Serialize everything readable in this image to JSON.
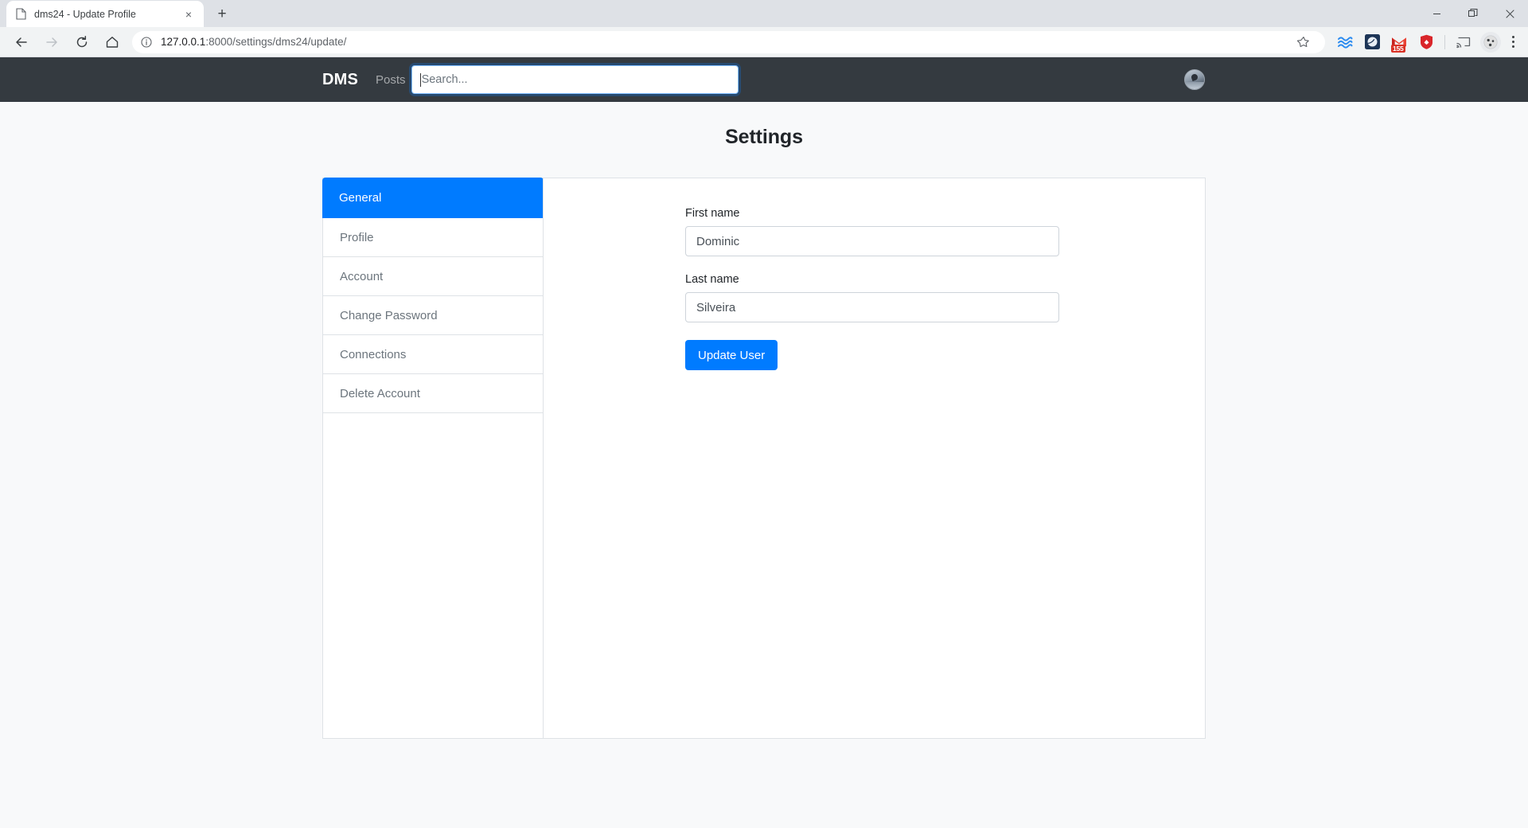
{
  "browser": {
    "tab": {
      "title": "dms24 - Update Profile",
      "favicon": "page-icon",
      "close": "×"
    },
    "new_tab": "+",
    "window_controls": {
      "minimize": "−",
      "maximize": "❐",
      "close": "✕"
    },
    "nav": {
      "back": "←",
      "forward": "→",
      "reload": "⟳",
      "home": "⌂"
    },
    "omnibox": {
      "info_icon": "info-icon",
      "url_host": "127.0.0.1",
      "url_path": ":8000/settings/dms24/update/",
      "bookmark_icon": "☆"
    },
    "extensions": [
      {
        "name": "wave-extension-icon",
        "badge": ""
      },
      {
        "name": "pocket-extension-icon",
        "badge": ""
      },
      {
        "name": "gmail-extension-icon",
        "badge": "155"
      },
      {
        "name": "shield-extension-icon",
        "badge": ""
      },
      {
        "name": "cast-icon",
        "badge": ""
      }
    ],
    "profile_avatar": "profile-avatar",
    "menu": "three-dot-menu"
  },
  "app": {
    "navbar": {
      "brand": "DMS",
      "posts_link": "Posts",
      "search_placeholder": "Search...",
      "avatar": "user-avatar"
    },
    "page_title": "Settings",
    "sidebar": {
      "items": [
        {
          "label": "General",
          "active": true
        },
        {
          "label": "Profile",
          "active": false
        },
        {
          "label": "Account",
          "active": false
        },
        {
          "label": "Change Password",
          "active": false
        },
        {
          "label": "Connections",
          "active": false
        },
        {
          "label": "Delete Account",
          "active": false
        }
      ]
    },
    "form": {
      "first_name_label": "First name",
      "first_name_value": "Dominic",
      "last_name_label": "Last name",
      "last_name_value": "Silveira",
      "submit_label": "Update User"
    }
  },
  "colors": {
    "accent": "#007bff",
    "navbar_bg": "#343a40",
    "page_bg": "#f8f9fa",
    "border": "#dee2e6"
  }
}
